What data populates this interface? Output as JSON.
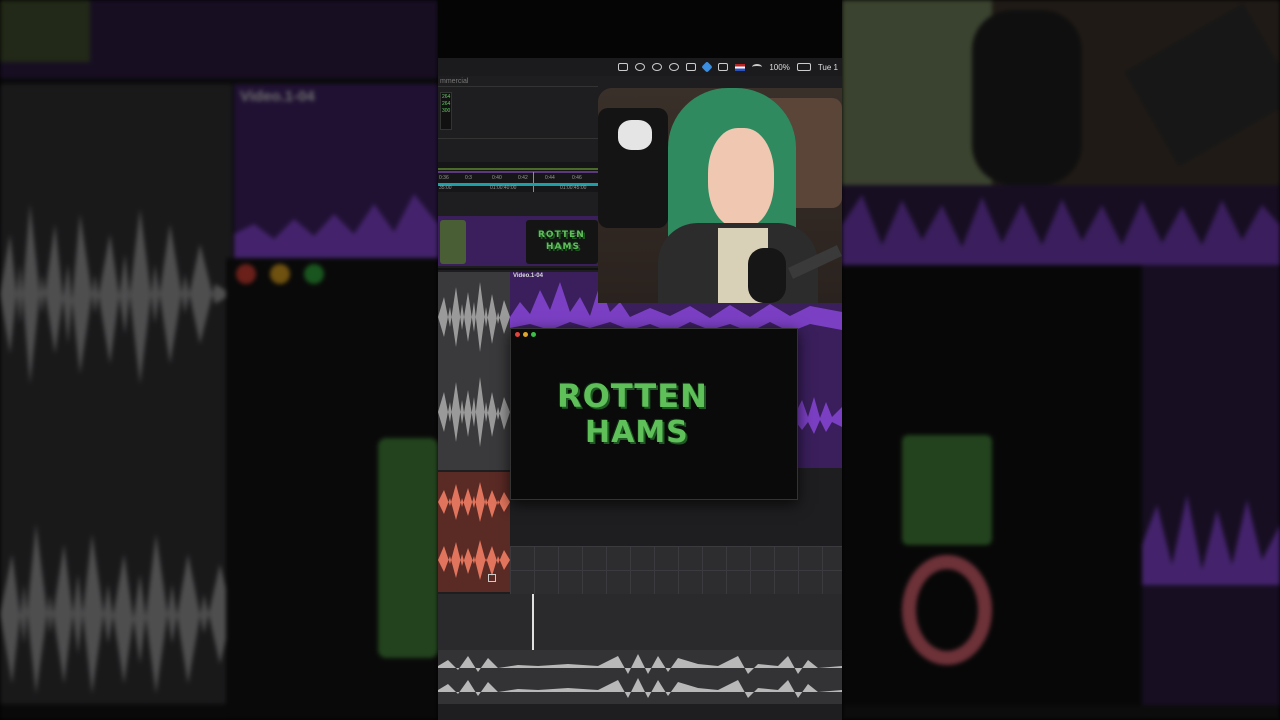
{
  "menubar": {
    "battery": "100%",
    "clock": "Tue 1"
  },
  "editor": {
    "project_label": "mmercial",
    "meta_values": [
      "264",
      "264",
      "300"
    ],
    "ruler_top": [
      "0:36",
      "0:3",
      "0:40",
      "0:42",
      "0:44",
      "0:46"
    ],
    "ruler_bottom": [
      "35:00",
      "01:00:40:00",
      "01:00:45:00"
    ],
    "clip_name": "Video.1-04"
  },
  "side": {
    "clip_name": "Video.1-04"
  },
  "logo": {
    "line1": "ROTTEN",
    "line2": "HAMS"
  },
  "colors": {
    "accent_purple": "#7b3fc4",
    "audio_gray": "#9a9a9a",
    "audio_red": "#e0745c",
    "logo_green": "#5fc05a",
    "logo_pink": "#e5707a"
  }
}
